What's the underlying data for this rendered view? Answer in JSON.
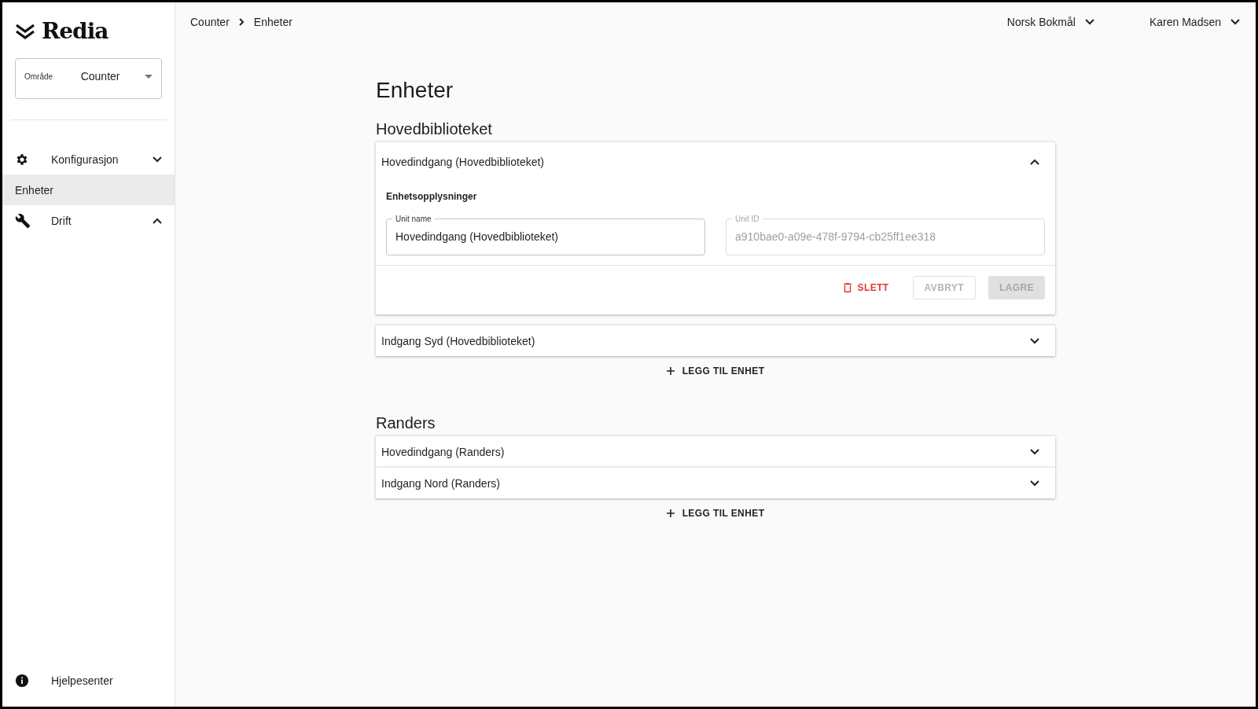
{
  "sidebar": {
    "logo": "Redia",
    "area_select": {
      "label": "Område",
      "value": "Counter"
    },
    "nav": [
      {
        "kind": "group",
        "label": "Konfigurasjon",
        "expanded": false,
        "selected": false
      },
      {
        "kind": "link",
        "label": "Enheter",
        "selected": true
      },
      {
        "kind": "group",
        "label": "Drift",
        "expanded": true,
        "selected": false
      }
    ],
    "help": {
      "label": "Hjelpesenter"
    }
  },
  "header": {
    "breadcrumb": [
      "Counter",
      "Enheter"
    ],
    "language": "Norsk Bokmål",
    "user": "Karen Madsen"
  },
  "page_title": "Enheter",
  "sections": [
    {
      "title": "Hovedbiblioteket",
      "add_label": "LEGG TIL ENHET",
      "units": [
        {
          "name": "Hovedindgang (Hovedbiblioteket)",
          "expanded": true,
          "details": {
            "heading": "Enhetsopplysninger",
            "fields": [
              {
                "label": "Unit name",
                "value": "Hovedindgang (Hovedbiblioteket)",
                "disabled": false
              },
              {
                "label": "Unit ID",
                "value": "a910bae0-a09e-478f-9794-cb25ff1ee318",
                "disabled": true
              }
            ],
            "actions": [
              {
                "kind": "delete",
                "label": "SLETT",
                "disabled": false
              },
              {
                "kind": "outlined",
                "label": "AVBRYT",
                "disabled": true
              },
              {
                "kind": "contained",
                "label": "LAGRE",
                "disabled": true
              }
            ]
          }
        },
        {
          "name": "Indgang Syd (Hovedbiblioteket)",
          "expanded": false
        }
      ]
    },
    {
      "title": "Randers",
      "add_label": "LEGG TIL ENHET",
      "units": [
        {
          "name": "Hovedindgang (Randers)",
          "expanded": false
        },
        {
          "name": "Indgang Nord (Randers)",
          "expanded": false
        }
      ]
    }
  ]
}
